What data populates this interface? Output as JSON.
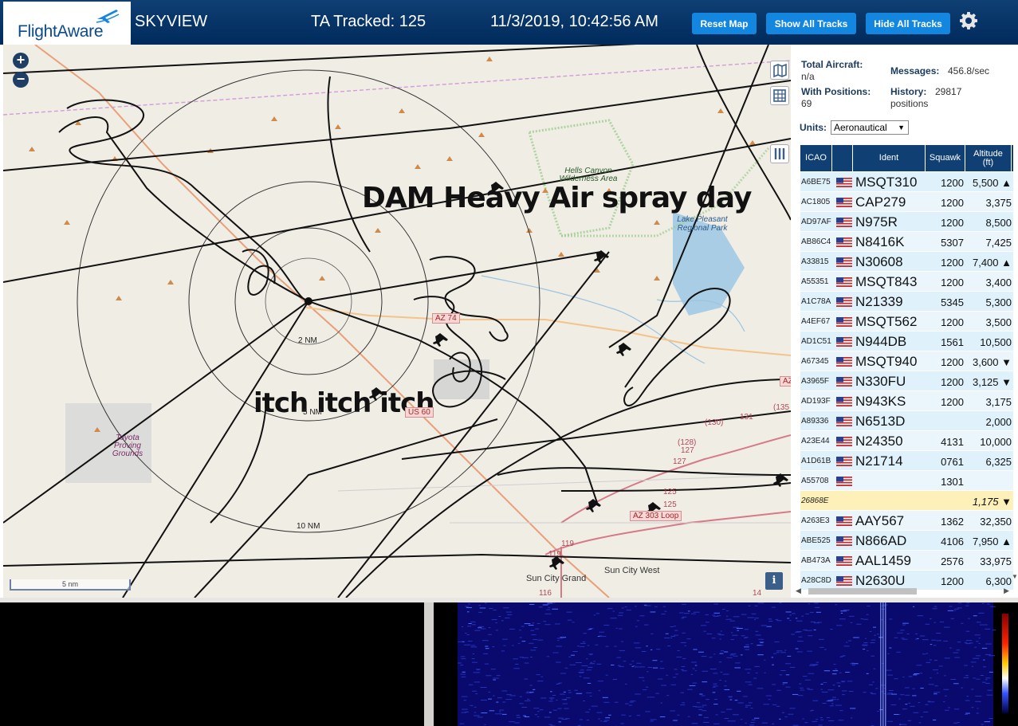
{
  "header": {
    "logo_text": "FlightAware",
    "app_title": "SKYVIEW",
    "ta_tracked": "TA Tracked: 125",
    "datetime": "11/3/2019, 10:42:56 AM",
    "buttons": {
      "reset": "Reset Map",
      "show_all": "Show All Tracks",
      "hide_all": "Hide All Tracks"
    },
    "settings_icon": "gear-icon"
  },
  "map": {
    "annotations": [
      "DAM Heavy Air spray day",
      "itch itch itch"
    ],
    "range_labels": [
      "2 NM",
      "5 NM",
      "10 NM"
    ],
    "places": {
      "wilderness": "Hells Canyon Wilderness Area",
      "lake": "Lake Pleasant Regional Park",
      "proving": "Toyota Proving Grounds",
      "town1": "Sun City Grand",
      "town2": "Sun City West"
    },
    "road_shields": [
      "AZ 74",
      "US 60",
      "AZ 303 Loop",
      "AZ"
    ],
    "route_numbers": [
      "(130)",
      "131",
      "(135",
      "(128)",
      "127",
      "127",
      "125",
      "125",
      "119",
      "119",
      "116",
      "14"
    ],
    "scale": "5 nm",
    "zoom_in": "+",
    "zoom_out": "−",
    "info": "i",
    "icons": [
      "map-layers-icon",
      "grid-icon",
      "columns-icon"
    ]
  },
  "stats": {
    "total_aircraft_label": "Total Aircraft:",
    "total_aircraft_value": "n/a",
    "messages_label": "Messages:",
    "messages_value": "456.8/sec",
    "with_positions_label": "With Positions:",
    "with_positions_value": "69",
    "history_label": "History:",
    "history_value": "29817",
    "history_unit": "positions",
    "units_label": "Units:",
    "units_value": "Aeronautical"
  },
  "table": {
    "headers": {
      "icao": "ICAO",
      "ident": "Ident",
      "squawk": "Squawk",
      "altitude": "Altitude",
      "altitude_unit": "(ft)"
    },
    "rows": [
      {
        "icao": "A6BE75",
        "flag": true,
        "ident": "MSQT310",
        "squawk": "1200",
        "alt": "5,500 ▲"
      },
      {
        "icao": "AC1805",
        "flag": true,
        "ident": "CAP279",
        "squawk": "1200",
        "alt": "3,375"
      },
      {
        "icao": "AD97AF",
        "flag": true,
        "ident": "N975R",
        "squawk": "1200",
        "alt": "8,500"
      },
      {
        "icao": "AB86C4",
        "flag": true,
        "ident": "N8416K",
        "squawk": "5307",
        "alt": "7,425"
      },
      {
        "icao": "A33815",
        "flag": true,
        "ident": "N30608",
        "squawk": "1200",
        "alt": "7,400 ▲"
      },
      {
        "icao": "A55351",
        "flag": true,
        "ident": "MSQT843",
        "squawk": "1200",
        "alt": "3,400"
      },
      {
        "icao": "A1C78A",
        "flag": true,
        "ident": "N21339",
        "squawk": "5345",
        "alt": "5,300"
      },
      {
        "icao": "A4EF67",
        "flag": true,
        "ident": "MSQT562",
        "squawk": "1200",
        "alt": "3,500"
      },
      {
        "icao": "AD1C51",
        "flag": true,
        "ident": "N944DB",
        "squawk": "1561",
        "alt": "10,500 ▼"
      },
      {
        "icao": "A67345",
        "flag": true,
        "ident": "MSQT940",
        "squawk": "1200",
        "alt": "3,600 ▼"
      },
      {
        "icao": "A3965F",
        "flag": true,
        "ident": "N330FU",
        "squawk": "1200",
        "alt": "3,125 ▼"
      },
      {
        "icao": "AD193F",
        "flag": true,
        "ident": "N943KS",
        "squawk": "1200",
        "alt": "3,175"
      },
      {
        "icao": "A89336",
        "flag": true,
        "ident": "N6513D",
        "squawk": "",
        "alt": "2,000"
      },
      {
        "icao": "A23E44",
        "flag": true,
        "ident": "N24350",
        "squawk": "4131",
        "alt": "10,000 ▼"
      },
      {
        "icao": "A1D61B",
        "flag": true,
        "ident": "N21714",
        "squawk": "0761",
        "alt": "6,325"
      },
      {
        "icao": "A55708",
        "flag": true,
        "ident": "",
        "squawk": "1301",
        "alt": ""
      },
      {
        "icao": "26868E",
        "flag": false,
        "ident": "",
        "squawk": "",
        "alt": "1,175 ▼",
        "selected": true
      },
      {
        "icao": "A263E3",
        "flag": true,
        "ident": "AAY567",
        "squawk": "1362",
        "alt": "32,350 ▼"
      },
      {
        "icao": "ABE525",
        "flag": true,
        "ident": "N866AD",
        "squawk": "4106",
        "alt": "7,950 ▲"
      },
      {
        "icao": "AB473A",
        "flag": true,
        "ident": "AAL1459",
        "squawk": "2576",
        "alt": "33,975"
      },
      {
        "icao": "A28C8D",
        "flag": true,
        "ident": "N2630U",
        "squawk": "1200",
        "alt": "6,300"
      }
    ]
  },
  "colors": {
    "header_bg": "#002a5c",
    "button_bg": "#1386e0",
    "table_header_bg": "#0f3f73",
    "row_bg": "#dff1fb",
    "selected_row_bg": "#fdf1b9",
    "map_bg": "#f0ede5",
    "waterfall_bg": "#0a0a6e"
  }
}
